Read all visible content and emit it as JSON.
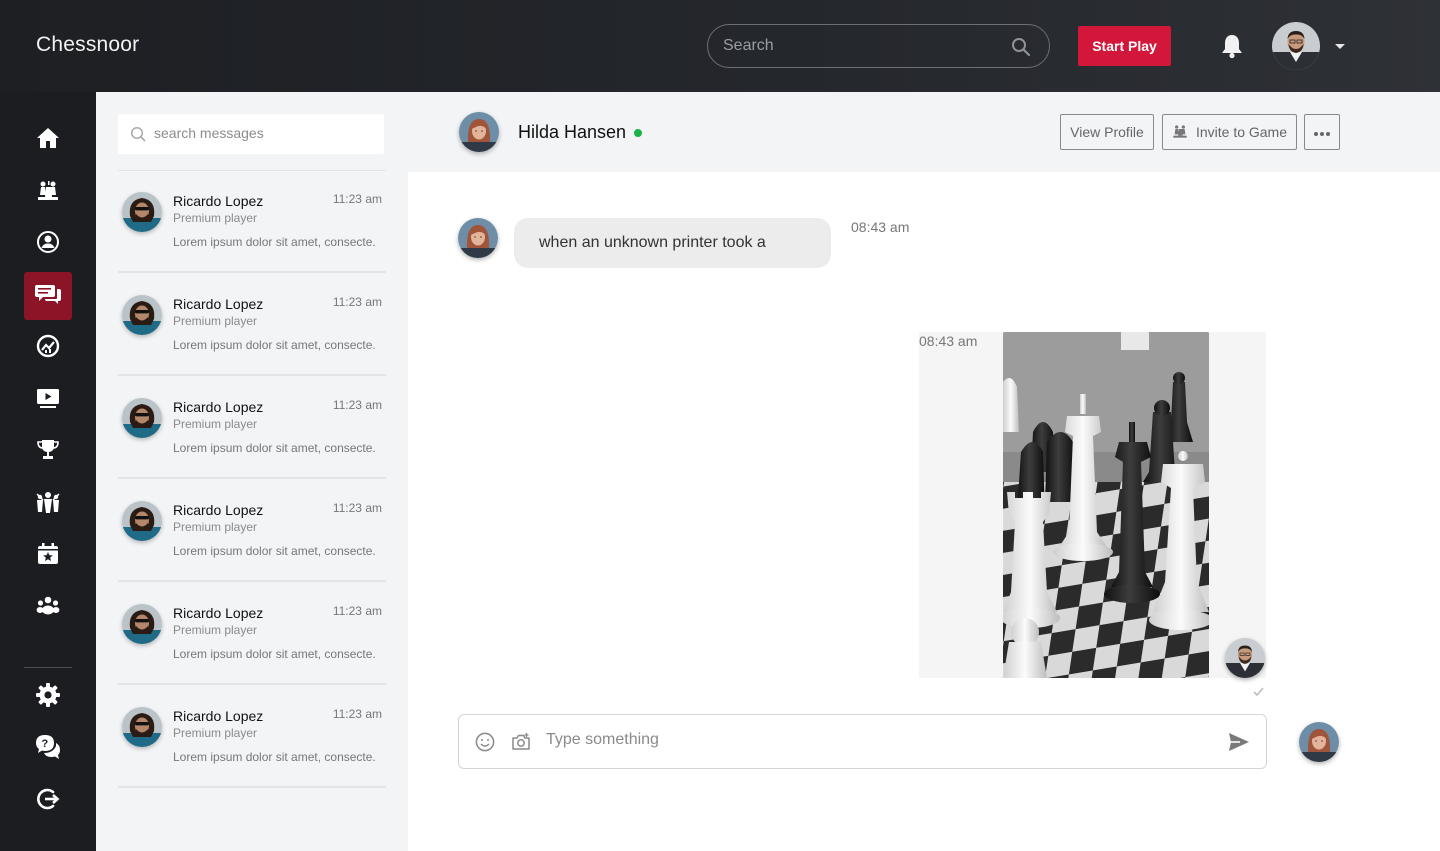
{
  "app": {
    "brand": "Chessnoor"
  },
  "header": {
    "search_placeholder": "Search",
    "start_play_label": "Start Play"
  },
  "nav": {
    "items": [
      "home-icon",
      "chess-pieces-icon",
      "profile-icon",
      "chat-icon",
      "analytics-icon",
      "video-icon",
      "trophy-icon",
      "group-icon",
      "calendar-icon",
      "community-icon"
    ],
    "bottom_items": [
      "settings-icon",
      "help-icon",
      "logout-icon"
    ],
    "active_item": "chat-icon",
    "active_color": "#8b1427"
  },
  "messages": {
    "search_placeholder": "search messages",
    "conversations": [
      {
        "name": "Ricardo Lopez",
        "time": "11:23 am",
        "subtitle": "Premium player",
        "preview": "Lorem ipsum dolor sit amet, consecte."
      },
      {
        "name": "Ricardo Lopez",
        "time": "11:23 am",
        "subtitle": "Premium player",
        "preview": "Lorem ipsum dolor sit amet, consecte."
      },
      {
        "name": "Ricardo Lopez",
        "time": "11:23 am",
        "subtitle": "Premium player",
        "preview": "Lorem ipsum dolor sit amet, consecte."
      },
      {
        "name": "Ricardo Lopez",
        "time": "11:23 am",
        "subtitle": "Premium player",
        "preview": "Lorem ipsum dolor sit amet, consecte."
      },
      {
        "name": "Ricardo Lopez",
        "time": "11:23 am",
        "subtitle": "Premium player",
        "preview": "Lorem ipsum dolor sit amet, consecte."
      },
      {
        "name": "Ricardo Lopez",
        "time": "11:23 am",
        "subtitle": "Premium player",
        "preview": "Lorem ipsum dolor sit amet, consecte."
      }
    ]
  },
  "chat": {
    "contact_name": "Hilda Hansen",
    "online": true,
    "view_profile_label": "View Profile",
    "invite_label": "Invite to Game",
    "incoming": {
      "text": "when an unknown printer took a",
      "time": "08:43 am"
    },
    "outgoing": {
      "time": "08:43 am",
      "image": "chess-pieces-photo",
      "status": "sent"
    },
    "composer_placeholder": "Type something"
  },
  "colors": {
    "accent": "#d3173a",
    "online": "#18b347",
    "topbar": "#1d1f23",
    "sidebar": "#1c1d20"
  }
}
